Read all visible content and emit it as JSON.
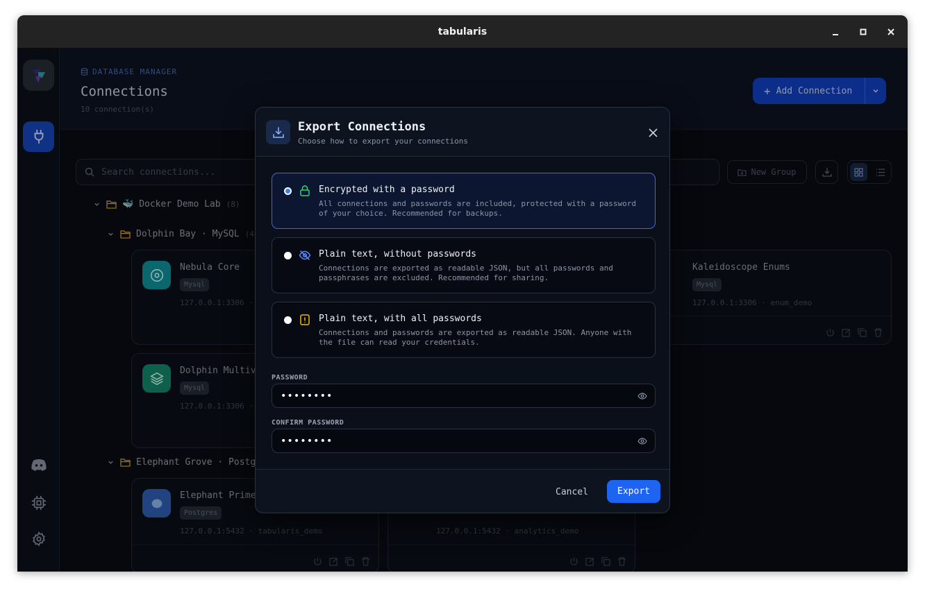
{
  "window": {
    "title": "tabularis"
  },
  "header": {
    "eyebrow": "DATABASE MANAGER",
    "title": "Connections",
    "count": "10 connection(s)",
    "add_label": "Add Connection"
  },
  "toolbar": {
    "search_placeholder": "Search connections...",
    "new_group": "New Group"
  },
  "groups": {
    "docker": {
      "name": "Docker Demo Lab",
      "count": "(8)"
    },
    "dolphin": {
      "name": "Dolphin Bay · MySQL",
      "count": "(4"
    },
    "elephant": {
      "name": "Elephant Grove · Postg"
    }
  },
  "cards": [
    {
      "name": "Nebula Core",
      "tag": "Mysql",
      "host": "127.0.0.1:3306 ·",
      "color": "#0f8f98"
    },
    {
      "name": "Kaleidoscope Enums",
      "tag": "Mysql",
      "host": "127.0.0.1:3306 · enum_demo",
      "color": "#d63b84"
    },
    {
      "name": "Dolphin Multiv",
      "tag": "Mysql",
      "host": "127.0.0.1:3306 ·",
      "color": "#13876a"
    },
    {
      "name": "Elephant Prime",
      "tag": "Postgres",
      "host": "127.0.0.1:5432 · tabularis_demo",
      "color": "#2f5fb3"
    },
    {
      "name": "",
      "tag": "",
      "host": "127.0.0.1:5432 · analytics_demo",
      "color": "#2f5fb3"
    }
  ],
  "modal": {
    "title": "Export Connections",
    "subtitle": "Choose how to export your connections",
    "options": [
      {
        "title": "Encrypted with a password",
        "desc": "All connections and passwords are included, protected with a password of your choice. Recommended for backups.",
        "icon": "lock-icon",
        "icon_color": "#2fd47a",
        "selected": true
      },
      {
        "title": "Plain text, without passwords",
        "desc": "Connections are exported as readable JSON, but all passwords and passphrases are excluded. Recommended for sharing.",
        "icon": "eye-off-icon",
        "icon_color": "#5b8cff",
        "selected": false
      },
      {
        "title": "Plain text, with all passwords",
        "desc": "Connections and passwords are exported as readable JSON. Anyone with the file can read your credentials.",
        "icon": "warning-icon",
        "icon_color": "#f2b705",
        "selected": false
      }
    ],
    "password_label": "PASSWORD",
    "password_value": "••••••••",
    "confirm_label": "CONFIRM PASSWORD",
    "confirm_value": "••••••••",
    "cancel": "Cancel",
    "export": "Export"
  },
  "colors": {
    "accent": "#1d64f2",
    "folder": "#e0a52c"
  }
}
